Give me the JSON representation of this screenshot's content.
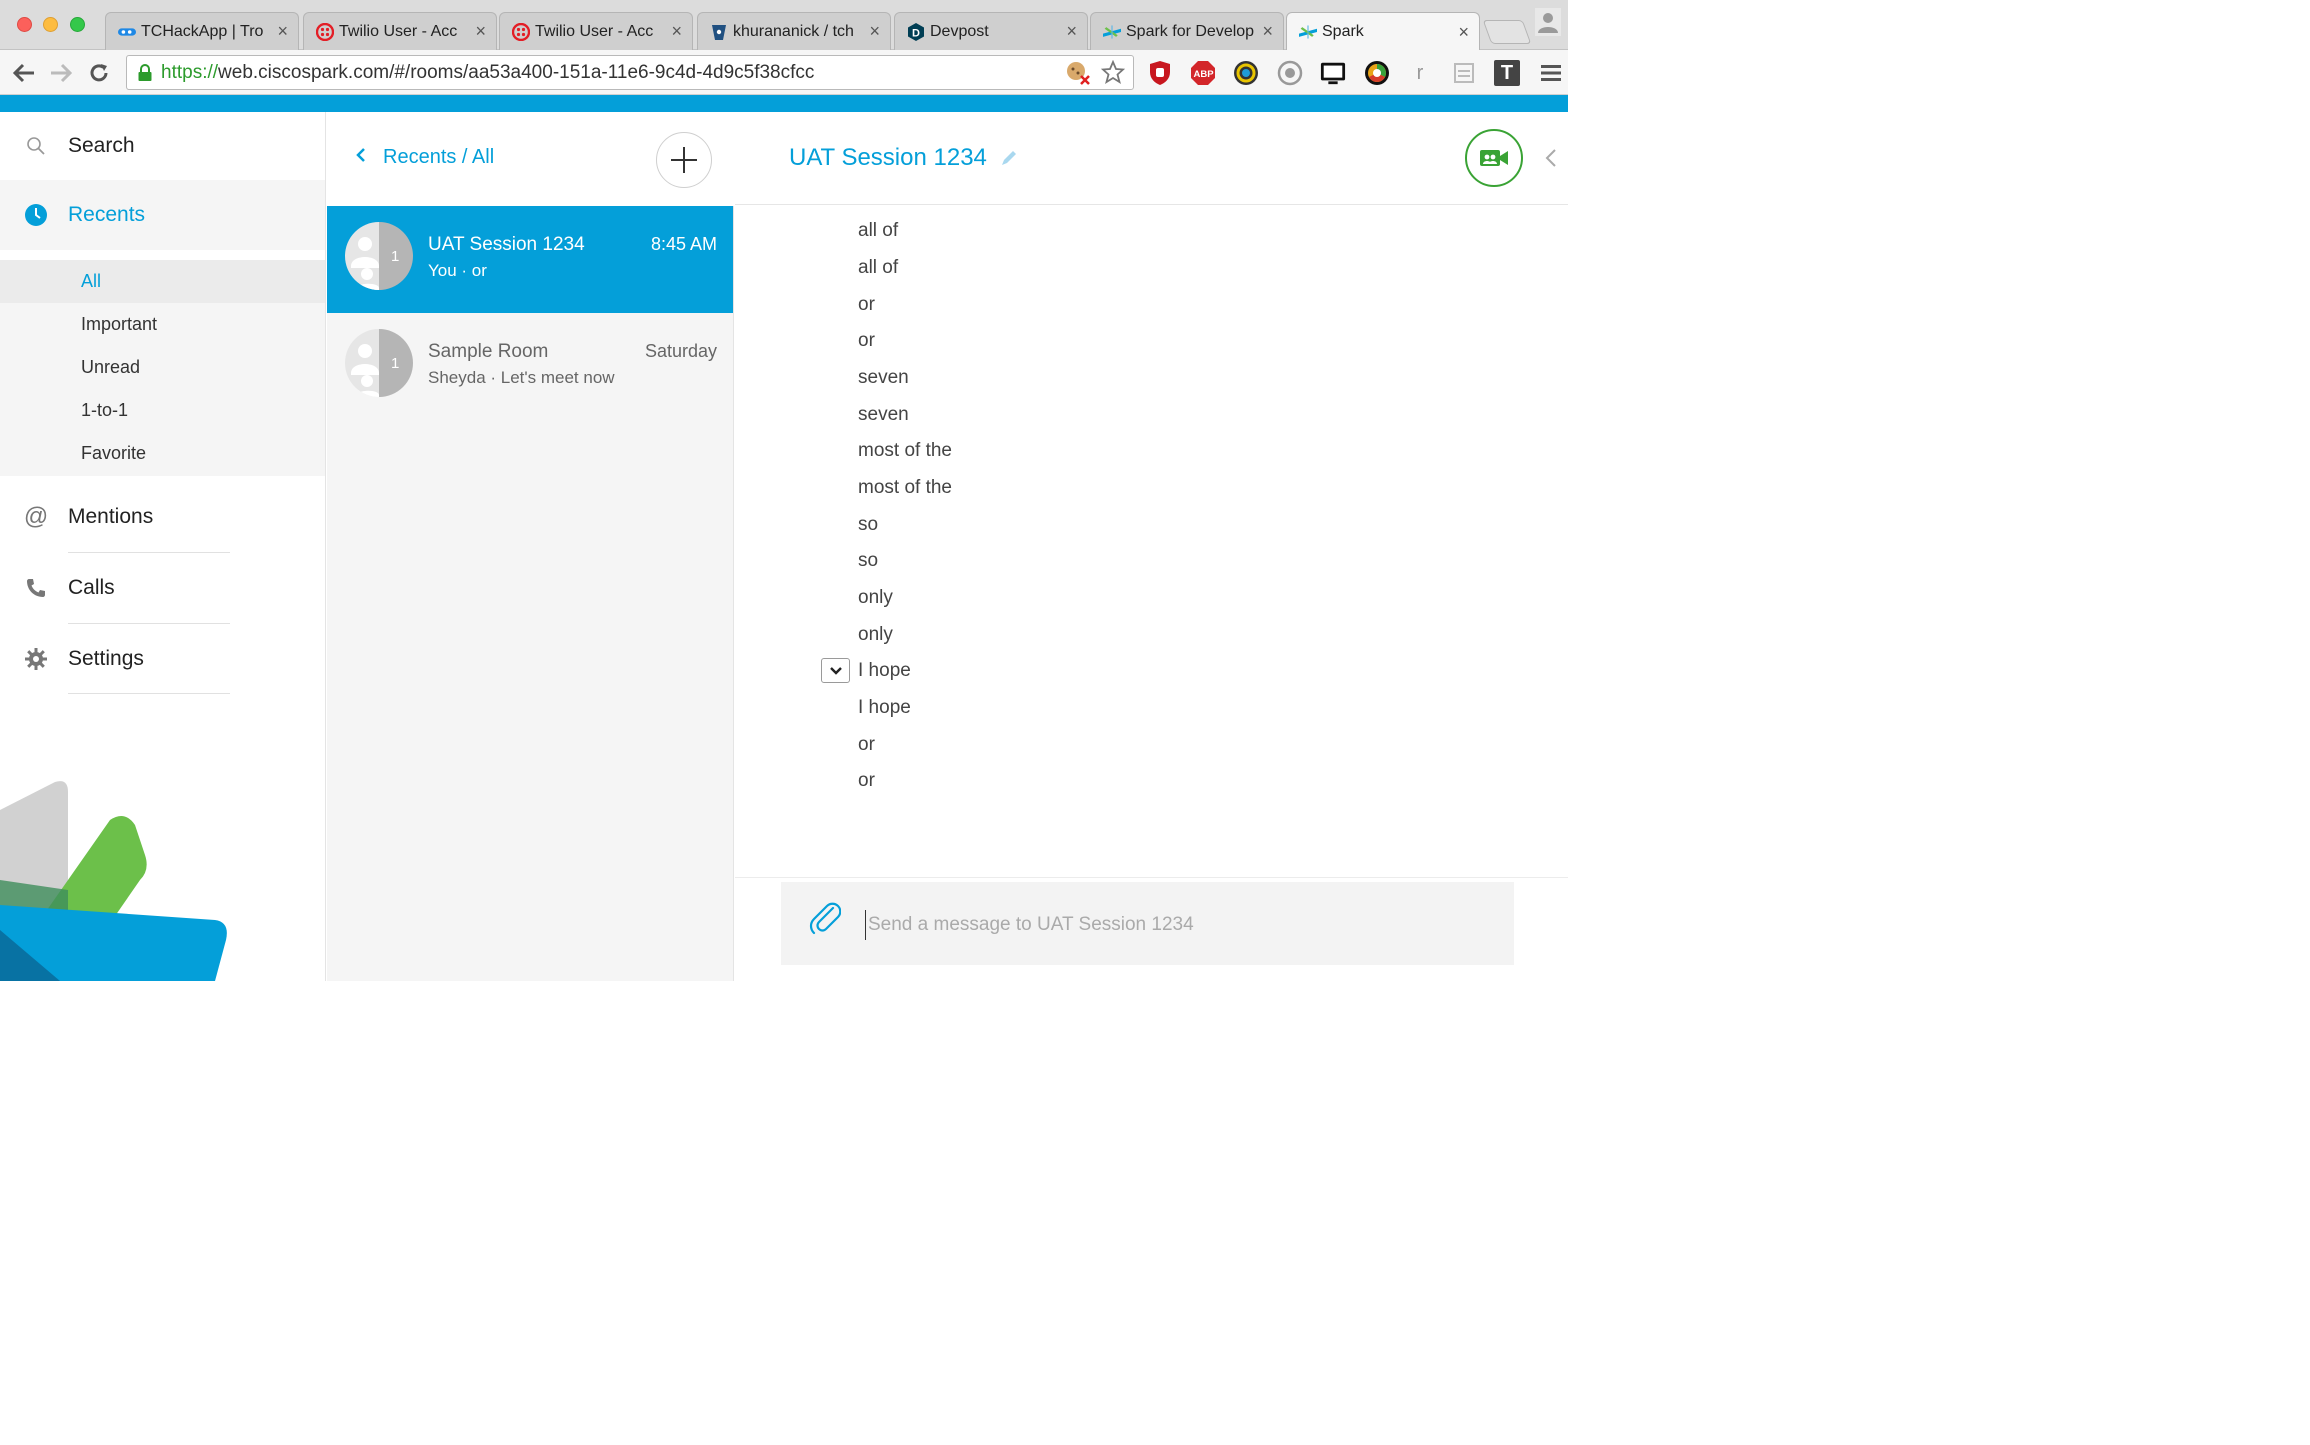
{
  "browser": {
    "tabs": [
      {
        "title": "TCHackApp | Tro",
        "close": "×"
      },
      {
        "title": "Twilio User - Acc",
        "close": "×"
      },
      {
        "title": "Twilio User - Acc",
        "close": "×"
      },
      {
        "title": "khurananick / tch",
        "close": "×"
      },
      {
        "title": "Devpost",
        "close": "×"
      },
      {
        "title": "Spark for Develop",
        "close": "×"
      },
      {
        "title": "Spark",
        "close": "×"
      }
    ],
    "url_scheme": "https://",
    "url_rest": "web.ciscospark.com/#/rooms/aa53a400-151a-11e6-9c4d-4d9c5f38cfcc",
    "extensions": [
      "ABP",
      "r",
      "T"
    ]
  },
  "nav": {
    "search": "Search",
    "recents": "Recents",
    "filters": [
      "All",
      "Important",
      "Unread",
      "1-to-1",
      "Favorite"
    ],
    "mentions": "Mentions",
    "calls": "Calls",
    "settings": "Settings"
  },
  "roomlist": {
    "breadcrumb": "Recents / All",
    "rooms": [
      {
        "name": "UAT Session 1234",
        "time": "8:45 AM",
        "preview": "You · or",
        "count": "1"
      },
      {
        "name": "Sample Room",
        "time": "Saturday",
        "preview": "Sheyda · Let's meet now",
        "count": "1"
      }
    ]
  },
  "conversation": {
    "title": "UAT Session 1234",
    "messages": [
      "all of",
      "all of",
      "or",
      "or",
      "seven",
      "seven",
      "most of the",
      "most of the",
      "so",
      "so",
      "only",
      "only",
      "I hope",
      "I hope",
      "or",
      "or"
    ],
    "composer_placeholder": "Send a message to UAT Session 1234"
  },
  "colors": {
    "accent": "#049fd9",
    "video_green": "#3aa335"
  }
}
